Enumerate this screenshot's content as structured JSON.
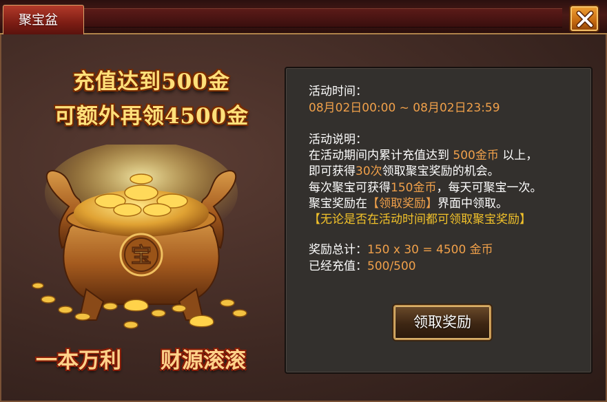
{
  "window": {
    "tab_title": "聚宝盆"
  },
  "promo": {
    "line1": "充值达到500金",
    "line2": "可额外再领4500金",
    "motto_left": "一本万利",
    "motto_right": "财源滚滚",
    "pot_glyph": "宝"
  },
  "activity": {
    "time_label": "活动时间：",
    "time_value": "08月02日00:00 ~ 08月02日23:59",
    "desc_label": "活动说明：",
    "desc_l1_a": "在活动期间内累计充值达到",
    "desc_l1_hl": "500金币",
    "desc_l1_b": "以上，",
    "desc_l2_a": "即可获得",
    "desc_l2_hl": "30次",
    "desc_l2_b": "领取聚宝奖励的机会。",
    "desc_l3_a": "每次聚宝可获得",
    "desc_l3_hl": "150金币",
    "desc_l3_b": "，每天可聚宝一次。",
    "desc_l4_a": "聚宝奖励在",
    "desc_l4_hl": "【领取奖励】",
    "desc_l4_b": "界面中领取。",
    "notice": "【无论是否在活动时间都可领取聚宝奖励】",
    "total_label": "奖励总计：",
    "total_value": "150 x 30 = 4500 金币",
    "recharged_label": "已经充值：",
    "recharged_value": "500/500",
    "claim_button": "领取奖励"
  },
  "colors": {
    "highlight": "#f0a04a",
    "notice": "#f2c22a",
    "tab_red": "#9b2a1e",
    "close_orange": "#e08a20"
  },
  "icons": [
    "close-icon",
    "treasure-pot-icon",
    "gold-coin-icon",
    "gold-ingot-icon"
  ]
}
